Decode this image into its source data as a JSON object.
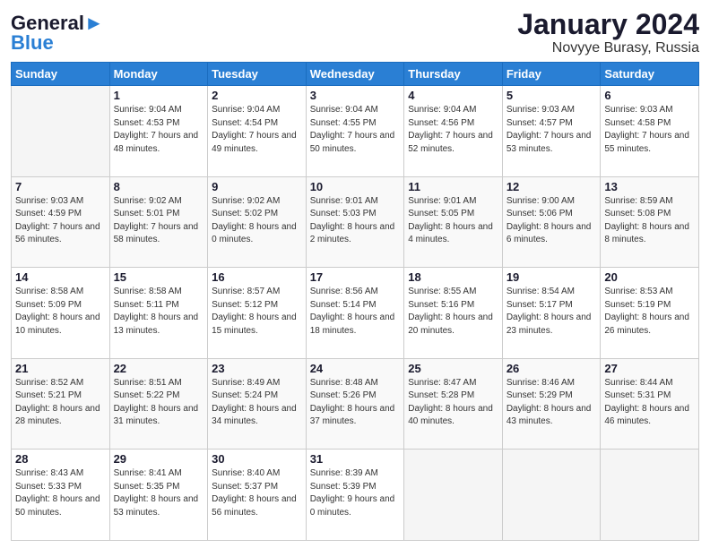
{
  "logo": {
    "line1": "General",
    "line2": "Blue"
  },
  "title": {
    "month_year": "January 2024",
    "location": "Novyye Burasy, Russia"
  },
  "days_of_week": [
    "Sunday",
    "Monday",
    "Tuesday",
    "Wednesday",
    "Thursday",
    "Friday",
    "Saturday"
  ],
  "weeks": [
    [
      {
        "day": "",
        "empty": true
      },
      {
        "day": "1",
        "sunrise": "9:04 AM",
        "sunset": "4:53 PM",
        "daylight": "7 hours and 48 minutes."
      },
      {
        "day": "2",
        "sunrise": "9:04 AM",
        "sunset": "4:54 PM",
        "daylight": "7 hours and 49 minutes."
      },
      {
        "day": "3",
        "sunrise": "9:04 AM",
        "sunset": "4:55 PM",
        "daylight": "7 hours and 50 minutes."
      },
      {
        "day": "4",
        "sunrise": "9:04 AM",
        "sunset": "4:56 PM",
        "daylight": "7 hours and 52 minutes."
      },
      {
        "day": "5",
        "sunrise": "9:03 AM",
        "sunset": "4:57 PM",
        "daylight": "7 hours and 53 minutes."
      },
      {
        "day": "6",
        "sunrise": "9:03 AM",
        "sunset": "4:58 PM",
        "daylight": "7 hours and 55 minutes."
      }
    ],
    [
      {
        "day": "7",
        "sunrise": "9:03 AM",
        "sunset": "4:59 PM",
        "daylight": "7 hours and 56 minutes."
      },
      {
        "day": "8",
        "sunrise": "9:02 AM",
        "sunset": "5:01 PM",
        "daylight": "7 hours and 58 minutes."
      },
      {
        "day": "9",
        "sunrise": "9:02 AM",
        "sunset": "5:02 PM",
        "daylight": "8 hours and 0 minutes."
      },
      {
        "day": "10",
        "sunrise": "9:01 AM",
        "sunset": "5:03 PM",
        "daylight": "8 hours and 2 minutes."
      },
      {
        "day": "11",
        "sunrise": "9:01 AM",
        "sunset": "5:05 PM",
        "daylight": "8 hours and 4 minutes."
      },
      {
        "day": "12",
        "sunrise": "9:00 AM",
        "sunset": "5:06 PM",
        "daylight": "8 hours and 6 minutes."
      },
      {
        "day": "13",
        "sunrise": "8:59 AM",
        "sunset": "5:08 PM",
        "daylight": "8 hours and 8 minutes."
      }
    ],
    [
      {
        "day": "14",
        "sunrise": "8:58 AM",
        "sunset": "5:09 PM",
        "daylight": "8 hours and 10 minutes."
      },
      {
        "day": "15",
        "sunrise": "8:58 AM",
        "sunset": "5:11 PM",
        "daylight": "8 hours and 13 minutes."
      },
      {
        "day": "16",
        "sunrise": "8:57 AM",
        "sunset": "5:12 PM",
        "daylight": "8 hours and 15 minutes."
      },
      {
        "day": "17",
        "sunrise": "8:56 AM",
        "sunset": "5:14 PM",
        "daylight": "8 hours and 18 minutes."
      },
      {
        "day": "18",
        "sunrise": "8:55 AM",
        "sunset": "5:16 PM",
        "daylight": "8 hours and 20 minutes."
      },
      {
        "day": "19",
        "sunrise": "8:54 AM",
        "sunset": "5:17 PM",
        "daylight": "8 hours and 23 minutes."
      },
      {
        "day": "20",
        "sunrise": "8:53 AM",
        "sunset": "5:19 PM",
        "daylight": "8 hours and 26 minutes."
      }
    ],
    [
      {
        "day": "21",
        "sunrise": "8:52 AM",
        "sunset": "5:21 PM",
        "daylight": "8 hours and 28 minutes."
      },
      {
        "day": "22",
        "sunrise": "8:51 AM",
        "sunset": "5:22 PM",
        "daylight": "8 hours and 31 minutes."
      },
      {
        "day": "23",
        "sunrise": "8:49 AM",
        "sunset": "5:24 PM",
        "daylight": "8 hours and 34 minutes."
      },
      {
        "day": "24",
        "sunrise": "8:48 AM",
        "sunset": "5:26 PM",
        "daylight": "8 hours and 37 minutes."
      },
      {
        "day": "25",
        "sunrise": "8:47 AM",
        "sunset": "5:28 PM",
        "daylight": "8 hours and 40 minutes."
      },
      {
        "day": "26",
        "sunrise": "8:46 AM",
        "sunset": "5:29 PM",
        "daylight": "8 hours and 43 minutes."
      },
      {
        "day": "27",
        "sunrise": "8:44 AM",
        "sunset": "5:31 PM",
        "daylight": "8 hours and 46 minutes."
      }
    ],
    [
      {
        "day": "28",
        "sunrise": "8:43 AM",
        "sunset": "5:33 PM",
        "daylight": "8 hours and 50 minutes."
      },
      {
        "day": "29",
        "sunrise": "8:41 AM",
        "sunset": "5:35 PM",
        "daylight": "8 hours and 53 minutes."
      },
      {
        "day": "30",
        "sunrise": "8:40 AM",
        "sunset": "5:37 PM",
        "daylight": "8 hours and 56 minutes."
      },
      {
        "day": "31",
        "sunrise": "8:39 AM",
        "sunset": "5:39 PM",
        "daylight": "9 hours and 0 minutes."
      },
      {
        "day": "",
        "empty": true
      },
      {
        "day": "",
        "empty": true
      },
      {
        "day": "",
        "empty": true
      }
    ]
  ]
}
